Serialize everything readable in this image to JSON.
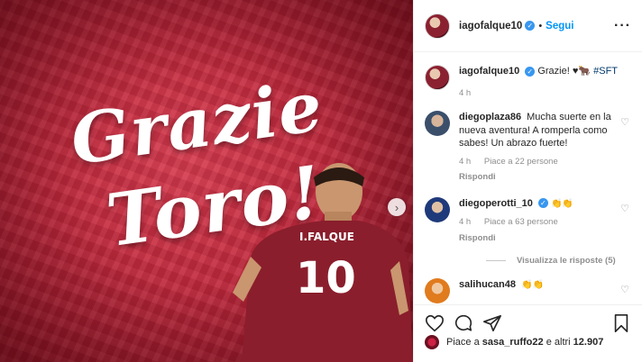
{
  "post": {
    "banner_line1": "Grazie",
    "banner_line2": "Toro!",
    "jersey_name": "I.FALQUE",
    "jersey_number": "10"
  },
  "header": {
    "username": "iagofalque10",
    "follow_label": "Segui"
  },
  "caption": {
    "username": "iagofalque10",
    "text": "Grazie! ♥🐂",
    "hashtag": "#SFT",
    "time": "4 h"
  },
  "comments": [
    {
      "username": "diegoplaza86",
      "text": "Mucha suerte en la nueva aventura! A romperla como sabes! Un abrazo fuerte!",
      "time": "4 h",
      "likes": "Piace a 22 persone",
      "reply": "Rispondi"
    },
    {
      "username": "diegoperotti_10",
      "text": "👏👏",
      "time": "4 h",
      "likes": "Piace a 63 persone",
      "reply": "Rispondi",
      "view_replies": "Visualizza le risposte (5)"
    },
    {
      "username": "salihucan48",
      "text": "👏👏"
    }
  ],
  "likes_summary": {
    "prefix": "Piace a",
    "user": "sasa_ruffo22",
    "suffix": "e altri",
    "count": "12.907"
  },
  "colors": {
    "brand_red": "#c0283c",
    "follow_blue": "#0095f6",
    "verified_blue": "#3897f0"
  }
}
